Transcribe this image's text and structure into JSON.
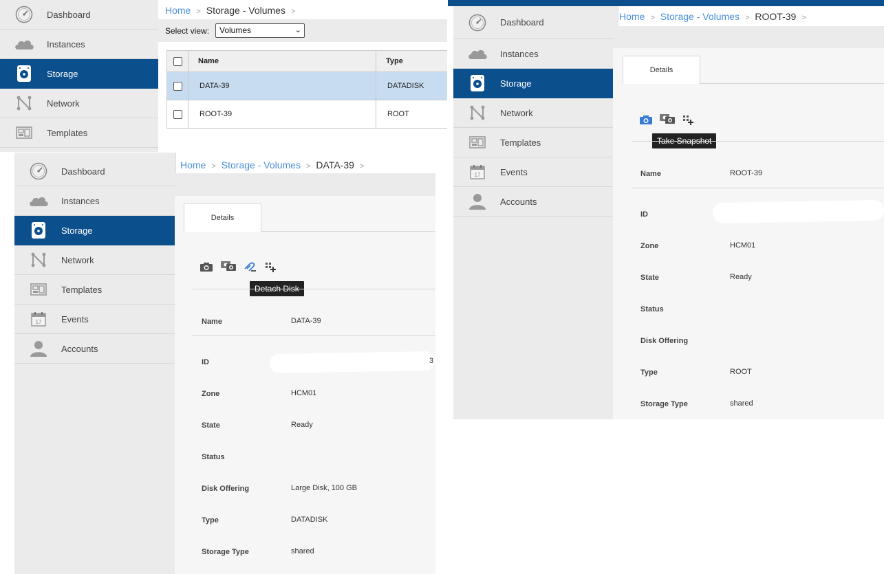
{
  "nav_labels": {
    "dashboard": "Dashboard",
    "instances": "Instances",
    "storage": "Storage",
    "network": "Network",
    "templates": "Templates",
    "events": "Events",
    "accounts": "Accounts"
  },
  "breadcrumb": {
    "home": "Home",
    "storage_volumes": "Storage - Volumes",
    "data_volume": "DATA-39",
    "root_volume": "ROOT-39",
    "separator": ">"
  },
  "volumes_list": {
    "select_view_label": "Select view:",
    "select_view_value": "Volumes",
    "columns": [
      "Name",
      "Type"
    ],
    "rows": [
      {
        "name": "DATA-39",
        "type": "DATADISK",
        "selected": true
      },
      {
        "name": "ROOT-39",
        "type": "ROOT",
        "selected": false
      }
    ]
  },
  "data_volume_detail": {
    "tab": "Details",
    "tooltip": "Detach Disk",
    "id_partial": "3",
    "props": {
      "name": {
        "label": "Name",
        "value": "DATA-39"
      },
      "id": {
        "label": "ID",
        "value": ""
      },
      "zone": {
        "label": "Zone",
        "value": "HCM01"
      },
      "state": {
        "label": "State",
        "value": "Ready"
      },
      "status": {
        "label": "Status",
        "value": ""
      },
      "disk_offering": {
        "label": "Disk Offering",
        "value": "Large Disk, 100 GB"
      },
      "type": {
        "label": "Type",
        "value": "DATADISK"
      },
      "storage_type": {
        "label": "Storage Type",
        "value": "shared"
      }
    }
  },
  "root_volume_detail": {
    "tab": "Details",
    "tooltip": "Take Snapshot",
    "props": {
      "name": {
        "label": "Name",
        "value": "ROOT-39"
      },
      "id": {
        "label": "ID",
        "value": ""
      },
      "zone": {
        "label": "Zone",
        "value": "HCM01"
      },
      "state": {
        "label": "State",
        "value": "Ready"
      },
      "status": {
        "label": "Status",
        "value": ""
      },
      "disk_offering": {
        "label": "Disk Offering",
        "value": ""
      },
      "type": {
        "label": "Type",
        "value": "ROOT"
      },
      "storage_type": {
        "label": "Storage Type",
        "value": "shared"
      }
    }
  },
  "colors": {
    "accent": "#0b4f8c",
    "link": "#4a90d9",
    "selected_row": "#c8dcf1",
    "sidebar_bg": "#ebebeb"
  },
  "icons": [
    "dashboard-gauge-icon",
    "cloud-icon",
    "disk-icon",
    "network-icon",
    "templates-icon",
    "calendar-icon",
    "user-icon",
    "camera-icon",
    "recurring-snapshot-icon",
    "detach-disk-icon",
    "migrate-icon"
  ]
}
